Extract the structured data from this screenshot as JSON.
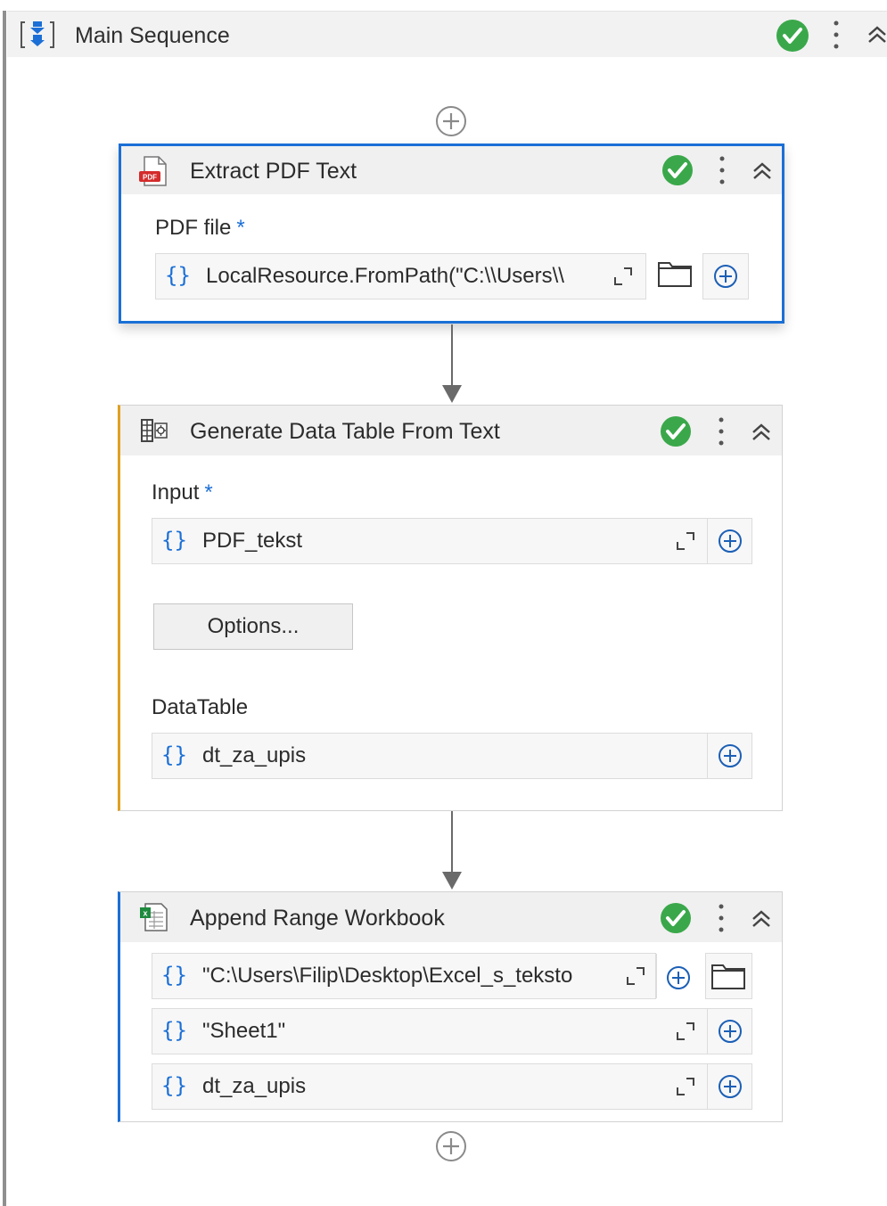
{
  "sequence": {
    "title": "Main Sequence"
  },
  "activities": [
    {
      "title": "Extract PDF Text",
      "fields": [
        {
          "label": "PDF file",
          "required": "*",
          "value": "LocalResource.FromPath(\"C:\\\\Users\\\\"
        }
      ]
    },
    {
      "title": "Generate Data Table From Text",
      "input_label": "Input",
      "input_required": "*",
      "input_value": "PDF_tekst",
      "options_label": "Options...",
      "datatable_label": "DataTable",
      "datatable_value": "dt_za_upis"
    },
    {
      "title": "Append Range Workbook",
      "fields": [
        {
          "value": "\"C:\\Users\\Filip\\Desktop\\Excel_s_teksto"
        },
        {
          "value": "\"Sheet1\""
        },
        {
          "value": "dt_za_upis"
        }
      ]
    }
  ],
  "braces_symbol": "{}",
  "colors": {
    "selected_border": "#1a6fd6",
    "accent_orange": "#e0a020",
    "accent_blue": "#1b6fd6",
    "check_green": "#3aa84a"
  }
}
